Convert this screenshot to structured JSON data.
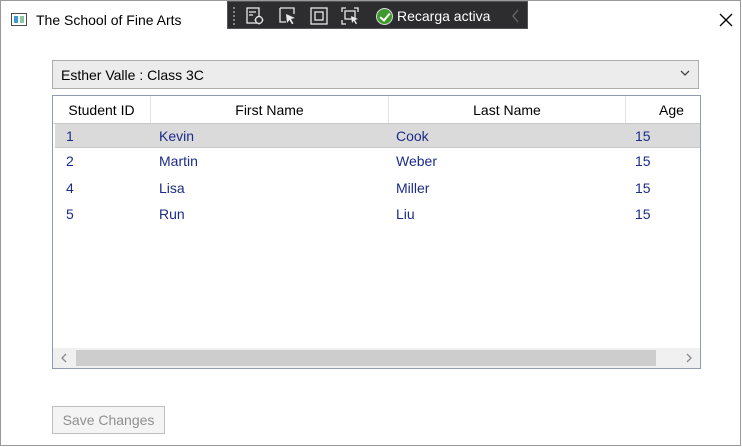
{
  "window": {
    "title": "The School of Fine Arts"
  },
  "devtools": {
    "reload_label": "Recarga activa"
  },
  "selector": {
    "value": "Esther Valle : Class 3C"
  },
  "table": {
    "headers": [
      "Student ID",
      "First Name",
      "Last Name",
      "Age"
    ],
    "rows": [
      [
        "1",
        "Kevin",
        "Cook",
        "15"
      ],
      [
        "2",
        "Martin",
        "Weber",
        "15"
      ],
      [
        "4",
        "Lisa",
        "Miller",
        "15"
      ],
      [
        "5",
        "Run",
        "Liu",
        "15"
      ]
    ],
    "selected_row_index": 0
  },
  "footer": {
    "save_label": "Save Changes"
  },
  "icons": {
    "app": "window-app-icon",
    "close": "close-icon",
    "devtools": [
      "visual-tree-icon",
      "select-element-icon",
      "display-layout-adorners-icon",
      "track-focus-icon",
      "check-circle-icon",
      "collapse-icon"
    ],
    "combo": "chevron-down-icon",
    "scroll": [
      "chevron-left-icon",
      "chevron-right-icon"
    ]
  },
  "colors": {
    "cell_text": "#1c2b8a",
    "selected_row": "#dadada",
    "devbar_bg": "#2d2d30",
    "reload_check": "#3e9a2d"
  }
}
